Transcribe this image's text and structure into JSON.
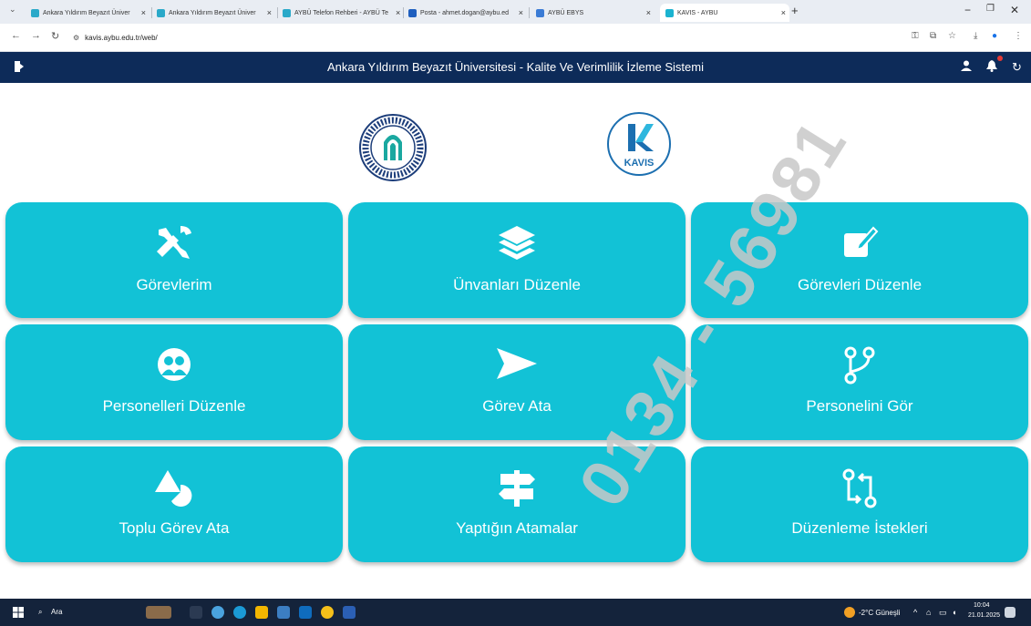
{
  "browser": {
    "tabs": [
      {
        "label": "Ankara Yıldırım Beyazıt Üniver"
      },
      {
        "label": "Ankara Yıldırım Beyazıt Üniver"
      },
      {
        "label": "AYBÜ Telefon Rehberi - AYBÜ Te"
      },
      {
        "label": "Posta - ahmet.dogan@aybu.ed"
      },
      {
        "label": "AYBÜ EBYS"
      },
      {
        "label": "KAVIS - AYBU"
      }
    ],
    "url": "kavis.aybu.edu.tr/web/"
  },
  "header": {
    "title": "Ankara Yıldırım Beyazıt Üniversitesi - Kalite Ve Verimlilik İzleme Sistemi"
  },
  "logos": {
    "kavis_text": "KAVIS"
  },
  "tiles": [
    {
      "label": "Görevlerim",
      "icon": "tools-icon"
    },
    {
      "label": "Ünvanları Düzenle",
      "icon": "layers-icon"
    },
    {
      "label": "Görevleri Düzenle",
      "icon": "edit-icon"
    },
    {
      "label": "Personelleri Düzenle",
      "icon": "users-icon"
    },
    {
      "label": "Görev Ata",
      "icon": "send-icon"
    },
    {
      "label": "Personelini Gör",
      "icon": "branch-icon"
    },
    {
      "label": "Toplu Görev Ata",
      "icon": "shapes-icon"
    },
    {
      "label": "Yaptığın Atamalar",
      "icon": "signpost-icon"
    },
    {
      "label": "Düzenleme İstekleri",
      "icon": "pull-request-icon"
    }
  ],
  "taskbar": {
    "search": "Ara",
    "weather": "-2°C Güneşli",
    "time": "10:04",
    "date": "21.01.2025"
  },
  "watermark": "0134 - 56981"
}
